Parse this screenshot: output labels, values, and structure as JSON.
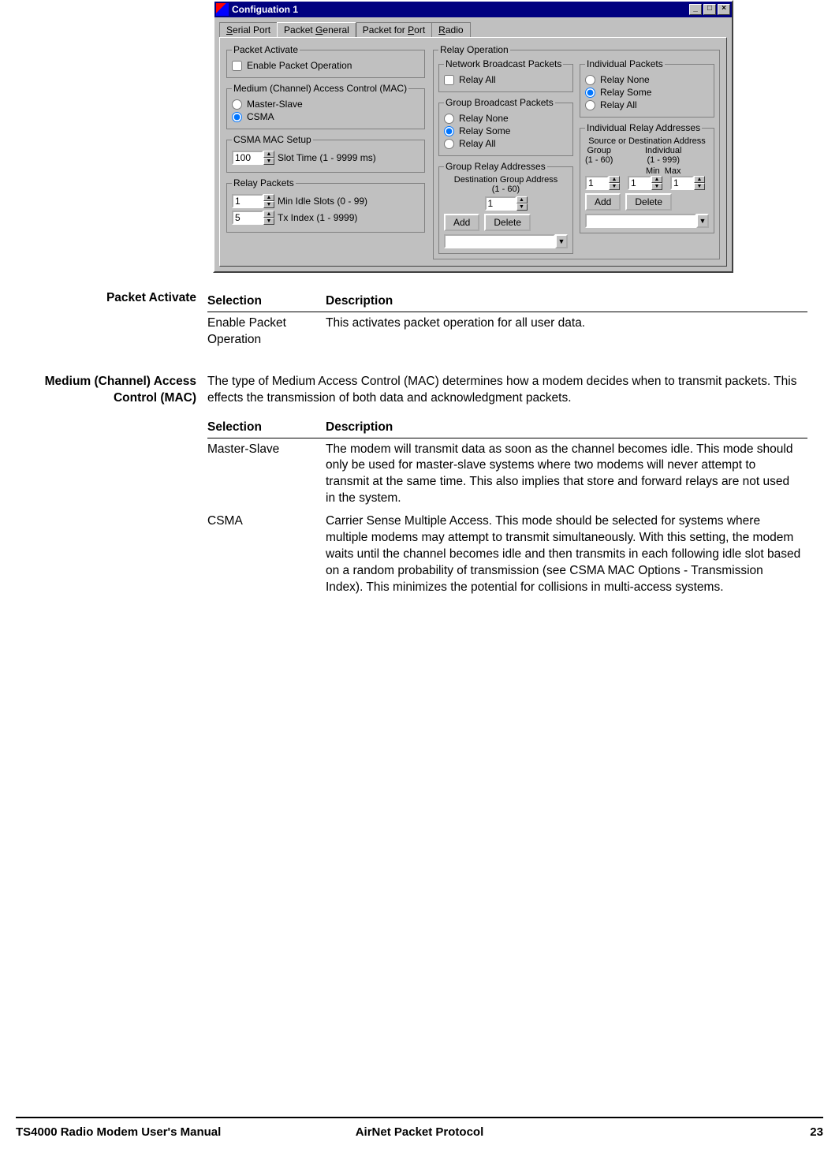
{
  "window": {
    "title": "Configuation 1",
    "tabs": [
      "Serial Port",
      "Packet General",
      "Packet for Port",
      "Radio"
    ],
    "tab_underline_idx": [
      0,
      7,
      16,
      0
    ],
    "active_tab": 1,
    "packet_activate": {
      "legend": "Packet Activate",
      "checkbox_label": "Enable Packet Operation",
      "checkbox_checked": false
    },
    "mac": {
      "legend": "Medium (Channel) Access Control (MAC)",
      "options": [
        {
          "label": "Master-Slave",
          "checked": false
        },
        {
          "label": "CSMA",
          "checked": true
        }
      ]
    },
    "csma_setup": {
      "legend": "CSMA MAC Setup",
      "slot_time_value": "100",
      "slot_time_label": "Slot Time (1 - 9999 ms)"
    },
    "relay_packets": {
      "legend": "Relay Packets",
      "min_idle_value": "1",
      "min_idle_label": "Min Idle Slots  (0 - 99)",
      "tx_index_value": "5",
      "tx_index_label": "Tx Index  (1 - 9999)"
    },
    "relay_operation": {
      "legend": "Relay Operation",
      "network_broadcast": {
        "legend": "Network Broadcast Packets",
        "checkbox_label": "Relay All",
        "checkbox_checked": false
      },
      "group_broadcast": {
        "legend": "Group Broadcast Packets",
        "options": [
          {
            "label": "Relay None",
            "checked": false
          },
          {
            "label": "Relay Some",
            "checked": true
          },
          {
            "label": "Relay All",
            "checked": false
          }
        ]
      },
      "group_relay_addr": {
        "legend": "Group Relay Addresses",
        "subtitle": "Destination Group Address\n(1 - 60)",
        "value": "1",
        "add": "Add",
        "delete": "Delete"
      },
      "individual_packets": {
        "legend": "Individual Packets",
        "options": [
          {
            "label": "Relay None",
            "checked": false
          },
          {
            "label": "Relay Some",
            "checked": true
          },
          {
            "label": "Relay All",
            "checked": false
          }
        ]
      },
      "individual_relay_addr": {
        "legend": "Individual Relay Addresses",
        "subtitle": "Source or Destination Address",
        "group_label": "Group\n(1 - 60)",
        "individual_label": "Individual\n(1 - 999)",
        "min_label": "Min",
        "max_label": "Max",
        "group_value": "1",
        "min_value": "1",
        "max_value": "1",
        "add": "Add",
        "delete": "Delete"
      }
    }
  },
  "doc": {
    "section1": {
      "label": "Packet Activate",
      "headers": [
        "Selection",
        "Description"
      ],
      "rows": [
        {
          "sel": "Enable Packet Operation",
          "desc": "This activates packet operation for all user data."
        }
      ]
    },
    "section2": {
      "label": "Medium (Channel) Access Control (MAC)",
      "intro": "The type of Medium Access Control (MAC) determines how a modem decides when to transmit packets.  This effects the transmission of both data and acknowledgment packets.",
      "headers": [
        "Selection",
        "Description"
      ],
      "rows": [
        {
          "sel": "Master-Slave",
          "desc": "The modem will transmit data as soon as the channel becomes idle.  This mode should only be used for master-slave systems where two modems will never attempt to transmit at the same time.  This also implies that store and forward relays are not used in the system."
        },
        {
          "sel": "CSMA",
          "desc": "Carrier Sense Multiple Access.  This mode should be selected for systems where multiple modems may attempt to transmit simultaneously.  With this setting, the modem waits until the channel becomes idle and then transmits in each following idle slot based on a random probability of transmission (see CSMA MAC Options - Transmission Index).  This minimizes the potential for collisions in multi-access systems."
        }
      ]
    }
  },
  "footer": {
    "left": "TS4000 Radio Modem User's Manual",
    "center": "AirNet Packet Protocol",
    "right": "23"
  }
}
